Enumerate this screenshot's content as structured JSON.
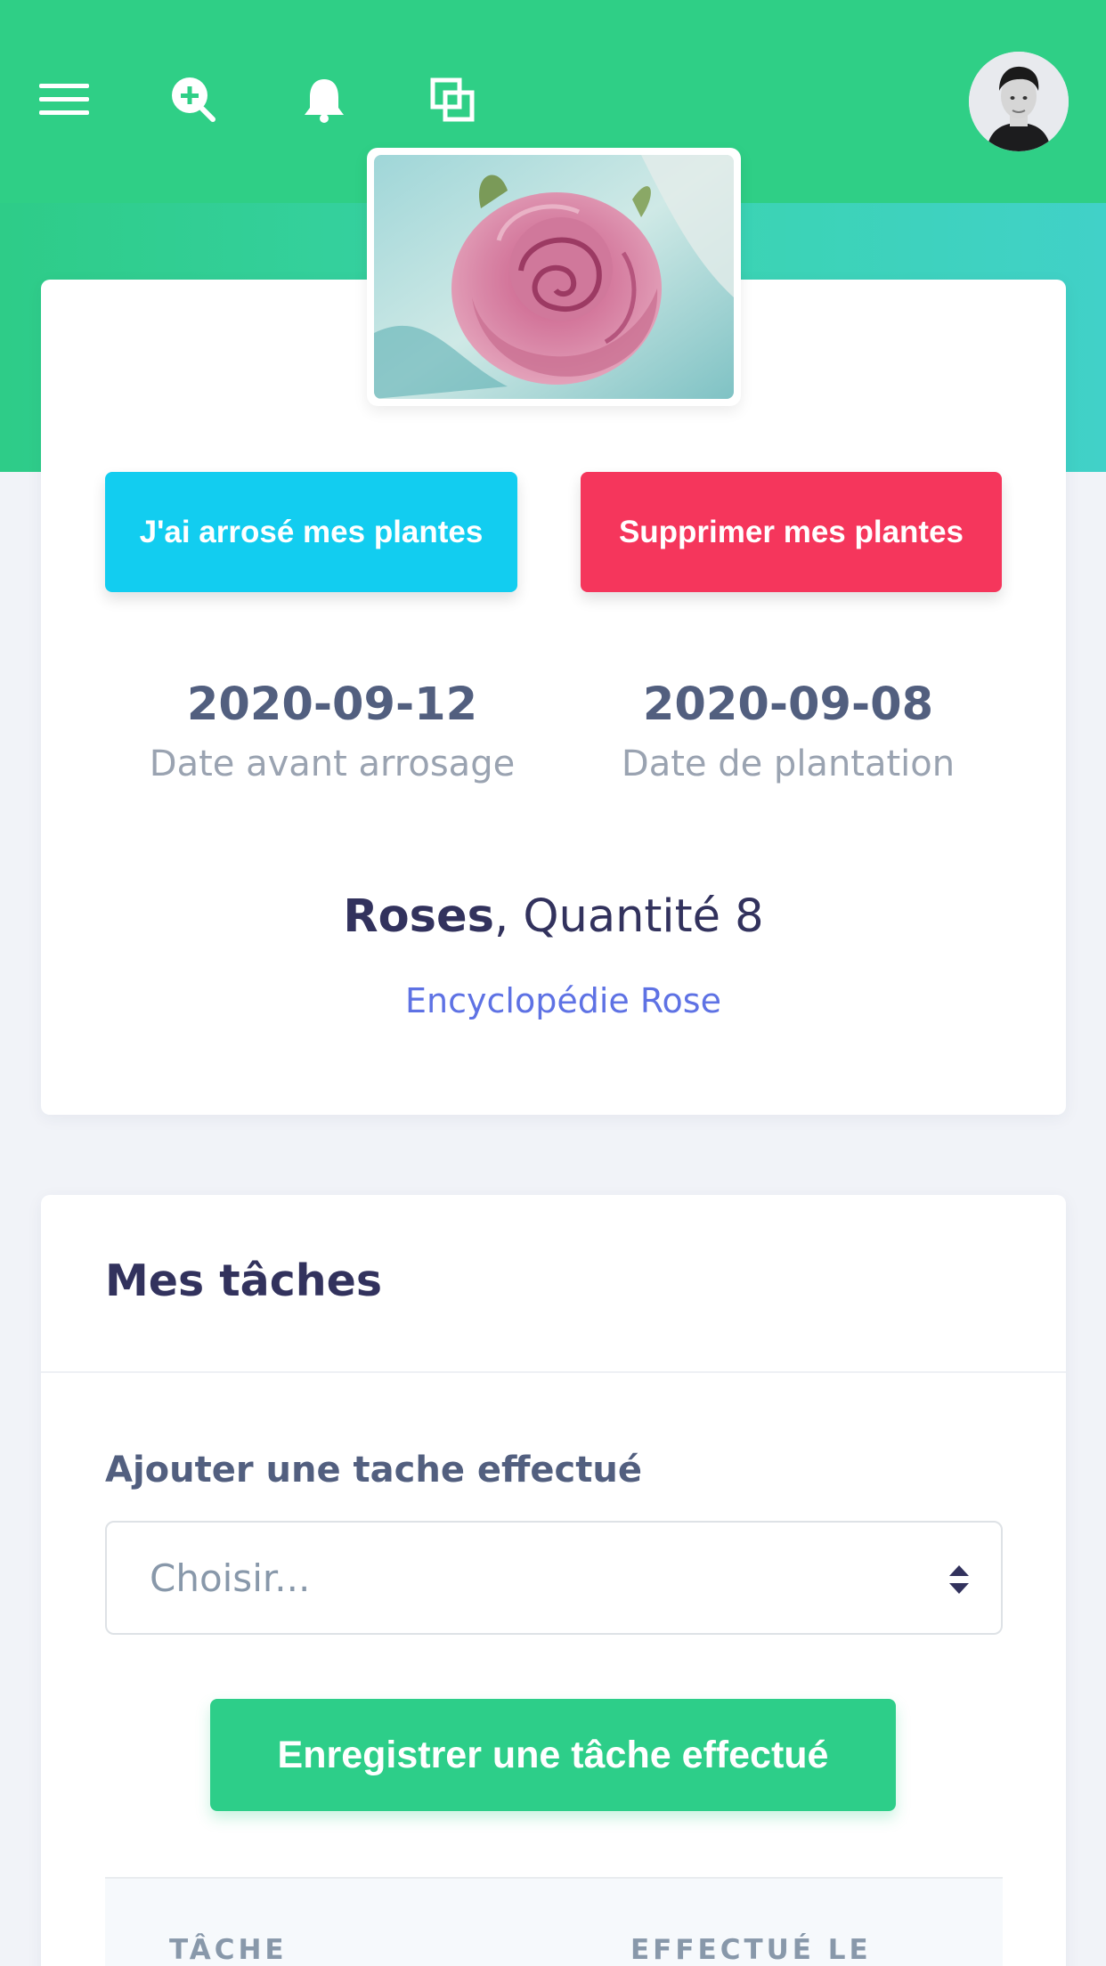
{
  "colors": {
    "header_green": "#2fcf86",
    "water_button": "#12cdf0",
    "delete_button": "#f5365c",
    "save_button": "#2dce89",
    "link": "#5e72e4"
  },
  "topbar": {
    "icons": [
      "menu-icon",
      "zoom-in-icon",
      "bell-icon",
      "windows-icon"
    ]
  },
  "profile": {
    "water_button": "J'ai arrosé mes plantes",
    "delete_button": "Supprimer mes plantes",
    "stats": [
      {
        "value": "2020-09-12",
        "label": "Date avant arrosage"
      },
      {
        "value": "2020-09-08",
        "label": "Date de plantation"
      }
    ],
    "plant_name": "Roses",
    "quantity": ", Quantité 8",
    "encyclopedia_link": "Encyclopédie Rose"
  },
  "tasks": {
    "title": "Mes tâches",
    "field_label": "Ajouter une tache effectué",
    "select_value": "Choisir...",
    "save_button": "Enregistrer une tâche effectué",
    "columns": [
      "TÂCHE",
      "EFFECTUÉ LE"
    ]
  }
}
